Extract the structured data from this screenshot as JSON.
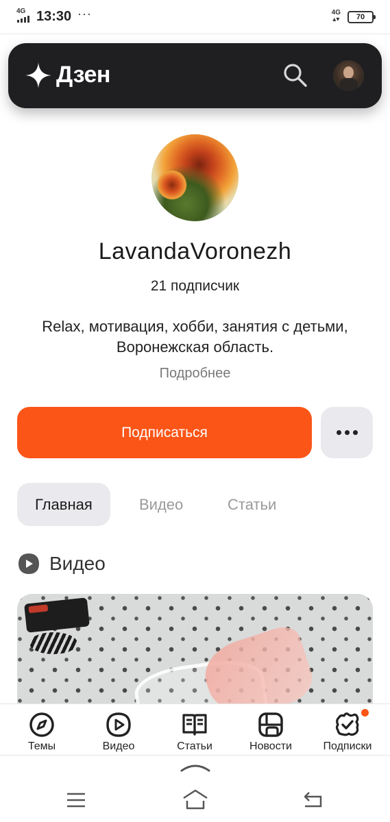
{
  "status_bar": {
    "network": "4G",
    "time": "13:30",
    "dots": "···",
    "network2": "4G",
    "battery": "70"
  },
  "header": {
    "logo_text": "Дзен"
  },
  "profile": {
    "channel_name": "LavandaVoronezh",
    "subscribers": "21 подписчик",
    "description_line1": "Relax, мотивация, хобби, занятия с детьми,",
    "description_line2": "Воронежская область.",
    "more_link": "Подробнее"
  },
  "actions": {
    "subscribe_label": "Подписаться"
  },
  "tabs": [
    {
      "label": "Главная",
      "active": true
    },
    {
      "label": "Видео",
      "active": false
    },
    {
      "label": "Статьи",
      "active": false
    }
  ],
  "section": {
    "title": "Видео"
  },
  "bottom_nav": [
    {
      "label": "Темы",
      "icon": "compass-icon"
    },
    {
      "label": "Видео",
      "icon": "video-play-icon"
    },
    {
      "label": "Статьи",
      "icon": "articles-icon"
    },
    {
      "label": "Новости",
      "icon": "news-icon"
    },
    {
      "label": "Подписки",
      "icon": "subscriptions-icon",
      "has_notification": true
    }
  ],
  "colors": {
    "accent": "#fb5517",
    "header_bg": "#1f1f22",
    "tab_active_bg": "#eaeaee"
  }
}
